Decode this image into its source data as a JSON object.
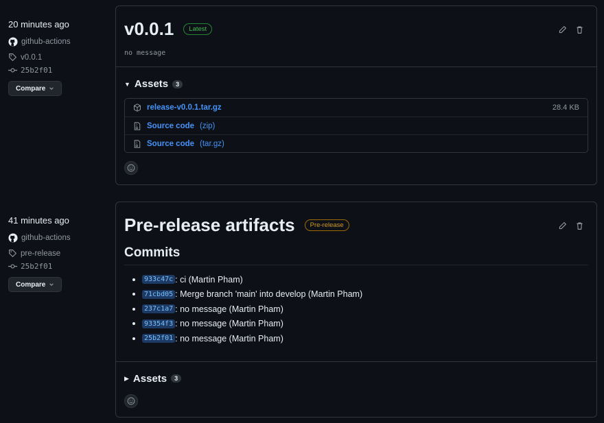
{
  "releases": [
    {
      "time": "20 minutes ago",
      "author": "github-actions",
      "tag": "v0.0.1",
      "commit": "25b2f01",
      "compare_label": "Compare",
      "title": "v0.0.1",
      "badge": "Latest",
      "message": "no message",
      "assets_label": "Assets",
      "assets_count": "3",
      "assets": [
        {
          "name": "release-v0.0.1.tar.gz",
          "ext": "",
          "size": "28.4 KB",
          "icon": "package-icon"
        },
        {
          "name": "Source code",
          "ext": "(zip)",
          "size": "",
          "icon": "file-zip-icon"
        },
        {
          "name": "Source code",
          "ext": "(tar.gz)",
          "size": "",
          "icon": "file-zip-icon"
        }
      ]
    },
    {
      "time": "41 minutes ago",
      "author": "github-actions",
      "tag": "pre-release",
      "commit": "25b2f01",
      "compare_label": "Compare",
      "title": "Pre-release artifacts",
      "badge": "Pre-release",
      "commits_heading": "Commits",
      "commits": [
        {
          "sha": "933c47c",
          "text": ": ci (Martin Pham)"
        },
        {
          "sha": "71cbd05",
          "text": ": Merge branch 'main' into develop (Martin Pham)"
        },
        {
          "sha": "237c1a7",
          "text": ": no message (Martin Pham)"
        },
        {
          "sha": "93354f3",
          "text": ": no message (Martin Pham)"
        },
        {
          "sha": "25b2f01",
          "text": ": no message (Martin Pham)"
        }
      ],
      "assets_label": "Assets",
      "assets_count": "3"
    }
  ],
  "colors": {
    "background": "#0d1117",
    "border": "#30363d",
    "link": "#4493f8",
    "latest": "#3fb950",
    "prerelease": "#d29922"
  }
}
